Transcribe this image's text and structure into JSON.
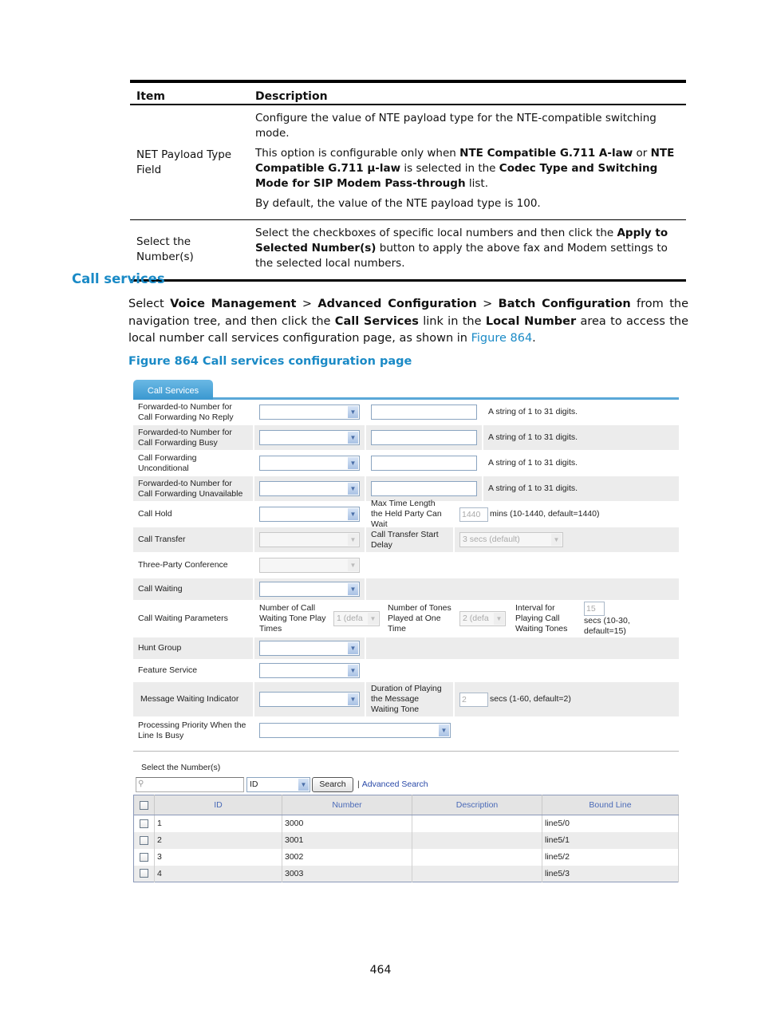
{
  "doc_table": {
    "headers": [
      "Item",
      "Description"
    ],
    "rows": [
      {
        "item": "NET Payload Type Field",
        "paragraphs": [
          [
            {
              "t": "Configure the value of NTE payload type for the NTE-compatible switching mode."
            }
          ],
          [
            {
              "t": "This option is configurable only when "
            },
            {
              "t": "NTE Compatible G.711 A-law",
              "b": true
            },
            {
              "t": " or "
            },
            {
              "t": "NTE Compatible G.711 µ-law",
              "b": true
            },
            {
              "t": " is selected in the "
            },
            {
              "t": "Codec Type and Switching Mode for SIP Modem Pass-through",
              "b": true
            },
            {
              "t": " list."
            }
          ],
          [
            {
              "t": "By default, the value of the NTE payload type is 100."
            }
          ]
        ]
      },
      {
        "item": "Select the Number(s)",
        "paragraphs": [
          [
            {
              "t": "Select the checkboxes of specific local numbers and then click the "
            },
            {
              "t": "Apply to Selected Number(s)",
              "b": true
            },
            {
              "t": " button to apply the above fax and Modem settings to the selected local numbers."
            }
          ]
        ]
      }
    ]
  },
  "section_title": "Call services",
  "intro": [
    {
      "t": "Select "
    },
    {
      "t": "Voice Management",
      "b": true
    },
    {
      "t": " > "
    },
    {
      "t": "Advanced Configuration",
      "b": true
    },
    {
      "t": " > "
    },
    {
      "t": "Batch Configuration",
      "b": true
    },
    {
      "t": " from the navigation tree, and then click the "
    },
    {
      "t": "Call Services",
      "b": true
    },
    {
      "t": " link in the "
    },
    {
      "t": "Local Number",
      "b": true
    },
    {
      "t": " area to access the local number call services configuration page, as shown in "
    },
    {
      "t": "Figure 864",
      "link": true
    },
    {
      "t": "."
    }
  ],
  "figure_caption": "Figure 864 Call services configuration page",
  "ui": {
    "tab_label": "Call Services",
    "hint_digits": "A string of 1 to 31 digits.",
    "rows": {
      "cfnr": "Forwarded-to Number for Call Forwarding No Reply",
      "cfb": "Forwarded-to Number for Call Forwarding Busy",
      "cfu": "Call Forwarding Unconditional",
      "cfua": "Forwarded-to Number for Call Forwarding Unavailable",
      "hold": "Call Hold",
      "hold_max_label": "Max Time Length the Held Party Can Wait",
      "hold_max_value": "1440",
      "hold_max_hint": "mins (10-1440, default=1440)",
      "transfer": "Call Transfer",
      "transfer_delay_label": "Call Transfer Start Delay",
      "transfer_delay_value": "3 secs (default)",
      "three_party": "Three-Party Conference",
      "waiting": "Call Waiting",
      "waiting_params": "Call Waiting Parameters",
      "tone_play_label": "Number of Call Waiting Tone Play Times",
      "tone_play_value": "1 (defa",
      "tones_one_time_label": "Number of Tones Played at One Time",
      "tones_one_time_value": "2 (defa",
      "interval_label": "Interval for Playing Call Waiting Tones",
      "interval_value": "15",
      "interval_hint": "secs (10-30, default=15)",
      "hunt": "Hunt Group",
      "feature": "Feature Service",
      "mwi": "Message Waiting Indicator",
      "mwi_dur_label": "Duration of Playing the Message Waiting Tone",
      "mwi_dur_value": "2",
      "mwi_dur_hint": "secs (1-60, default=2)",
      "priority": "Processing Priority When the Line Is Busy"
    },
    "select_numbers_title": "Select the Number(s)",
    "search": {
      "placeholder": "",
      "field_value": "ID",
      "button": "Search",
      "advanced": "Advanced Search"
    },
    "grid": {
      "headers": [
        "ID",
        "Number",
        "Description",
        "Bound Line"
      ],
      "rows": [
        {
          "id": "1",
          "number": "3000",
          "description": "",
          "line": "line5/0"
        },
        {
          "id": "2",
          "number": "3001",
          "description": "",
          "line": "line5/1"
        },
        {
          "id": "3",
          "number": "3002",
          "description": "",
          "line": "line5/2"
        },
        {
          "id": "4",
          "number": "3003",
          "description": "",
          "line": "line5/3"
        }
      ]
    }
  },
  "page_number": "464"
}
